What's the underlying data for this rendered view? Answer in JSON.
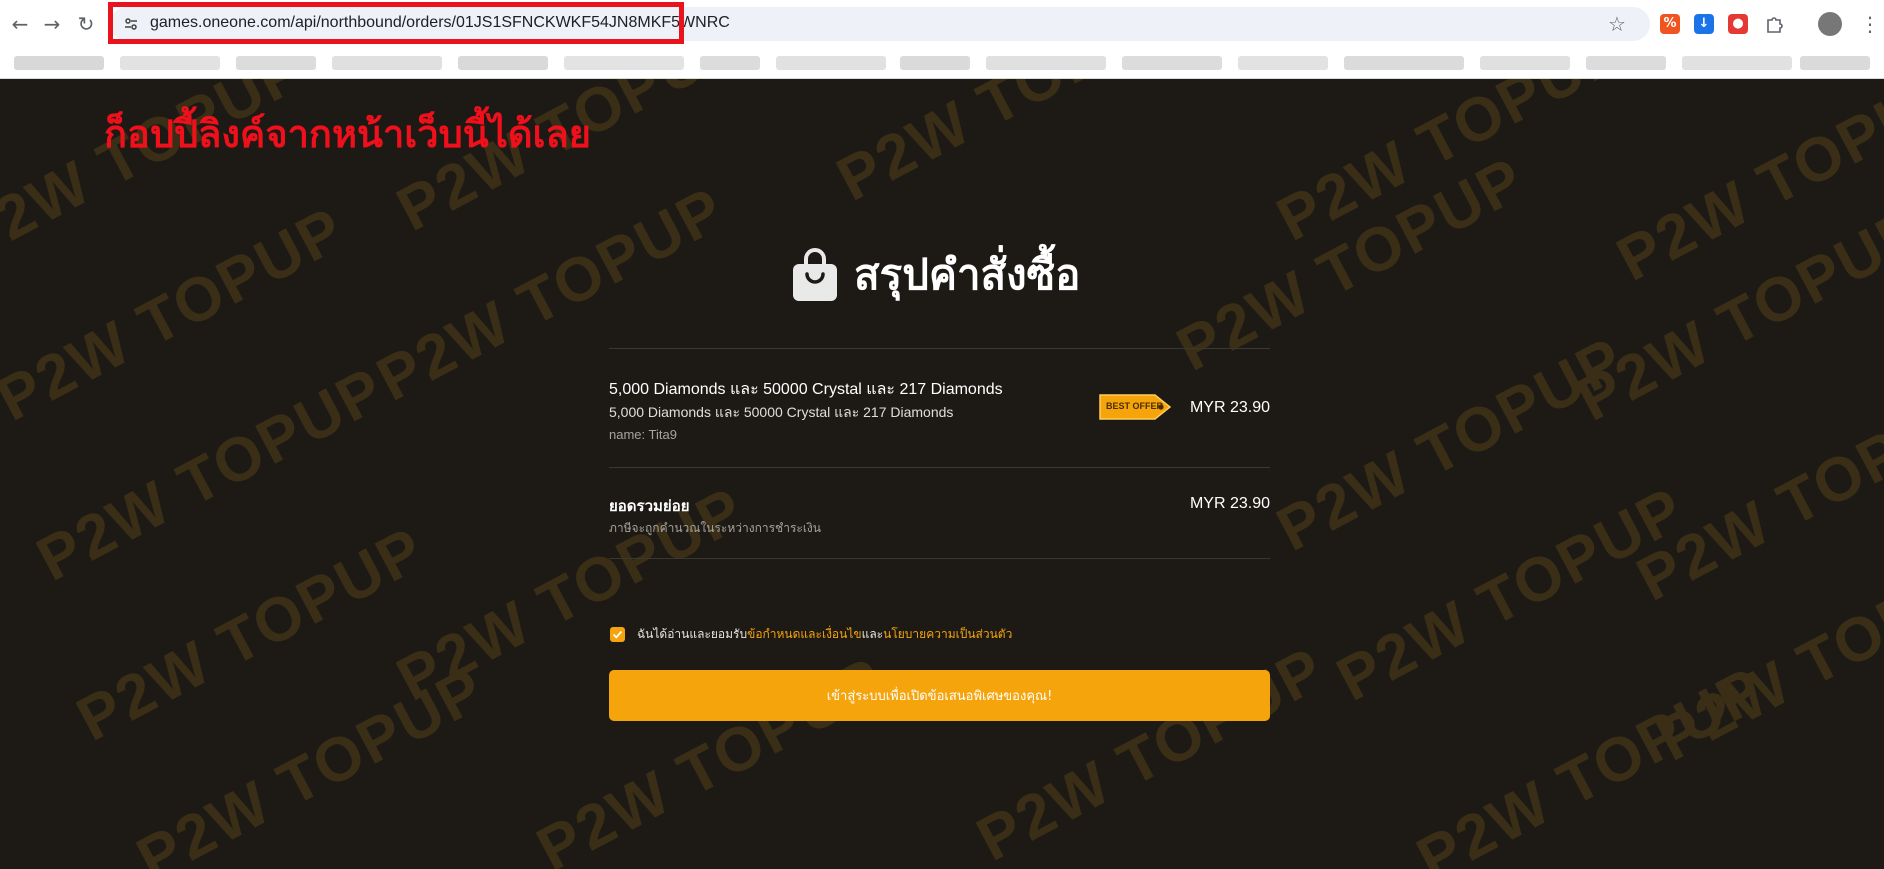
{
  "browser": {
    "url": "games.oneone.com/api/northbound/orders/01JS1SFNCKWKF54JN8MKF5WNRC",
    "back_glyph": "←",
    "forward_glyph": "→",
    "reload_glyph": "↻",
    "star_glyph": "☆",
    "menu_glyph": "⋮",
    "extension_colors": [
      "#f0551f",
      "#1a73e8",
      "#e53935"
    ]
  },
  "annotation": {
    "text": "ก็อปปี้ลิงค์จากหน้าเว็บนี้ได้เลย",
    "color": "#f0101c"
  },
  "watermark": {
    "text": "P2W TOPUP"
  },
  "order": {
    "title": "สรุปคำสั่งซื้อ",
    "item": {
      "title": "5,000 Diamonds และ 50000 Crystal และ 217 Diamonds",
      "subtitle": "5,000 Diamonds และ 50000 Crystal และ 217 Diamonds",
      "name": "name: Tita9",
      "badge": "BEST OFFER",
      "price": "MYR 23.90"
    },
    "subtotal": {
      "label": "ยอดรวมย่อย",
      "note": "ภาษีจะถูกคำนวณในระหว่างการชำระเงิน",
      "price": "MYR 23.90"
    },
    "agreement": {
      "checked": true,
      "prefix": "ฉันได้อ่านและยอมรับ",
      "terms_link": "ข้อกำหนดและเงื่อนไข",
      "joiner": "และ",
      "privacy_link": "นโยบายความเป็นส่วนตัว"
    },
    "cta_label": "เข้าสู่ระบบเพื่อเปิดข้อเสนอพิเศษของคุณ!"
  },
  "colors": {
    "accent": "#f5a40c",
    "background": "#1d1a16",
    "highlight_box": "#e8131d"
  }
}
